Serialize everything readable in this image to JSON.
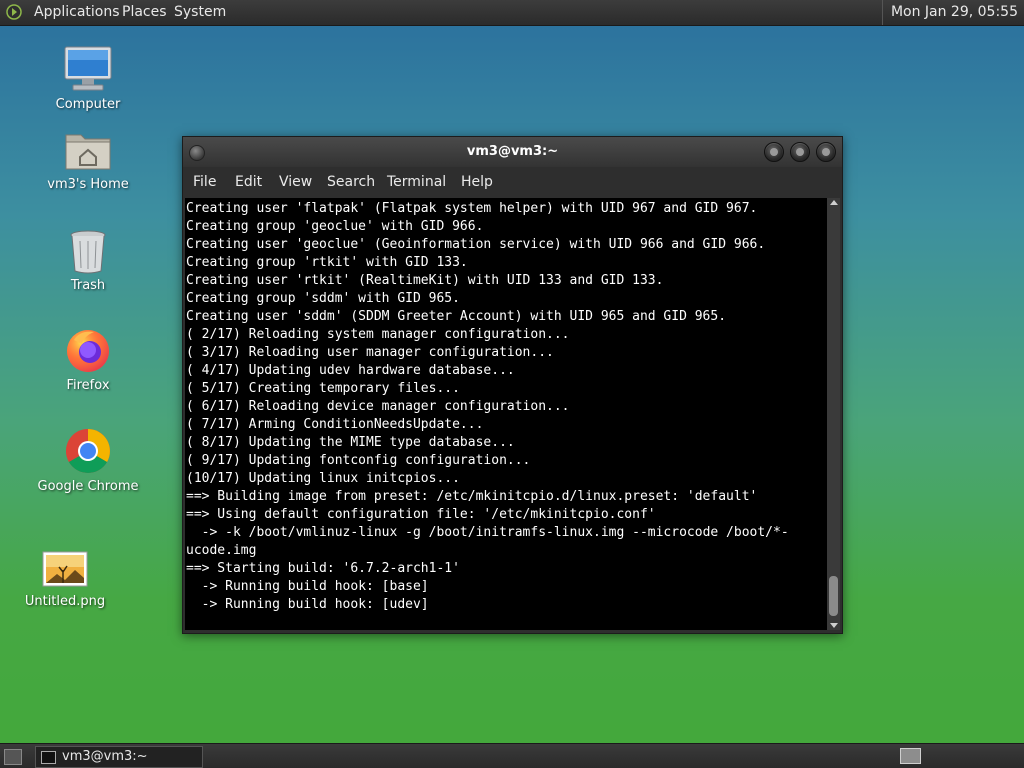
{
  "top_panel": {
    "menus": [
      "Applications",
      "Places",
      "System"
    ],
    "clock": "Mon Jan 29, 05:55"
  },
  "desktop_icons": [
    {
      "label": "Computer",
      "icon": "computer-icon"
    },
    {
      "label": "vm3's Home",
      "icon": "home-folder-icon"
    },
    {
      "label": "Trash",
      "icon": "trash-icon"
    },
    {
      "label": "Firefox",
      "icon": "firefox-icon"
    },
    {
      "label": "Google Chrome",
      "icon": "chrome-icon"
    },
    {
      "label": "Untitled.png",
      "icon": "image-file-icon"
    }
  ],
  "terminal": {
    "title": "vm3@vm3:~",
    "menu": [
      "File",
      "Edit",
      "View",
      "Search",
      "Terminal",
      "Help"
    ],
    "output": [
      "Creating user 'flatpak' (Flatpak system helper) with UID 967 and GID 967.",
      "Creating group 'geoclue' with GID 966.",
      "Creating user 'geoclue' (Geoinformation service) with UID 966 and GID 966.",
      "Creating group 'rtkit' with GID 133.",
      "Creating user 'rtkit' (RealtimeKit) with UID 133 and GID 133.",
      "Creating group 'sddm' with GID 965.",
      "Creating user 'sddm' (SDDM Greeter Account) with UID 965 and GID 965.",
      "( 2/17) Reloading system manager configuration...",
      "( 3/17) Reloading user manager configuration...",
      "( 4/17) Updating udev hardware database...",
      "( 5/17) Creating temporary files...",
      "( 6/17) Reloading device manager configuration...",
      "( 7/17) Arming ConditionNeedsUpdate...",
      "( 8/17) Updating the MIME type database...",
      "( 9/17) Updating fontconfig configuration...",
      "(10/17) Updating linux initcpios...",
      "==> Building image from preset: /etc/mkinitcpio.d/linux.preset: 'default'",
      "==> Using default configuration file: '/etc/mkinitcpio.conf'",
      "  -> -k /boot/vmlinuz-linux -g /boot/initramfs-linux.img --microcode /boot/*-ucode.img",
      "==> Starting build: '6.7.2-arch1-1'",
      "  -> Running build hook: [base]",
      "  -> Running build hook: [udev]"
    ]
  },
  "taskbar": {
    "task_label": "vm3@vm3:~"
  },
  "colors": {
    "panel": "#2f2f2f",
    "terminal_bg": "#000000",
    "terminal_fg": "#ffffff"
  }
}
